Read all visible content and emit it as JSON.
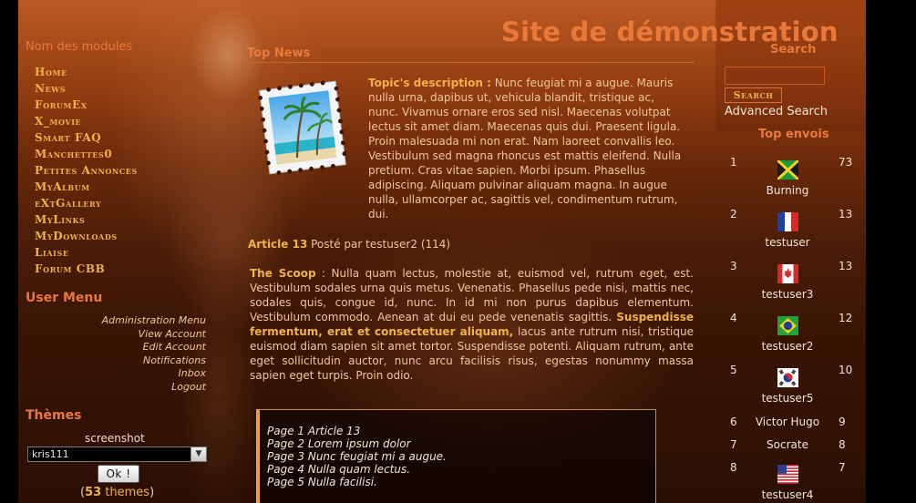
{
  "header": {
    "site_title": "Site de démonstration"
  },
  "sidebar": {
    "modules_title": "Nom des modules",
    "main_menu": [
      "Home",
      "News",
      "ForumEx",
      "X_movie",
      "Smart FAQ",
      "Manchettes0",
      "Petites Annonces",
      "MyAlbum",
      "eXtGallery",
      "MyLinks",
      "MyDownloads",
      "Liaise",
      "Forum CBB"
    ],
    "user_menu_title": "User Menu",
    "user_menu": [
      "Administration Menu",
      "View Account",
      "Edit Account",
      "Notifications",
      "Inbox",
      "Logout"
    ],
    "themes_title": "Thèmes",
    "screenshot_label": "screenshot",
    "theme_selected": "kris111",
    "ok_label": "Ok !",
    "themes_count_open": "(",
    "themes_count": "53",
    "themes_count_word": "themes",
    "themes_count_close": ")"
  },
  "main": {
    "top_news_title": "Top News",
    "topic_desc_label": "Topic's description :",
    "topic_desc_text": "Nunc feugiat mi a augue. Mauris nulla urna, dapibus ut, vehicula blandit, tristique ac, nunc. Vivamus ornare eros sed nisl. Maecenas volutpat lectus sit amet diam. Maecenas quis dui. Praesent ligula. Proin malesuada mi non erat. Nam laoreet convallis leo. Vestibulum sed magna rhoncus est mattis eleifend. Nulla pretium. Cras vitae sapien. Morbi ipsum. Phasellus adipiscing. Aliquam pulvinar aliquam magna. In augue nulla, ullamcorper ac, sagittis vel, condimentum rutrum, dui.",
    "article_title": "Article 13",
    "article_posted": "Posté par testuser2 (114)",
    "scoop_label": "The Scoop",
    "scoop_text_1": " : Nulla quam lectus, molestie at, euismod vel, rutrum eget, est. Vestibulum sodales urna quis metus. Venenatis. Phasellus pede nisi, mattis nec, sodales quis, congue id, nunc. In id mi non purus dapibus elementum. Vestibulum commodo. Aenean at dui eu pede venenatis sagittis. ",
    "scoop_bold": "Suspendisse fermentum, erat et consectetuer aliquam,",
    "scoop_text_2": " lacus ante rutrum nisi, tristique euismod diam sapien sit amet tortor. Suspendisse potenti. Aliquam rutrum, ante eget sollicitudin auctor, nunc arcu facilisis risus, egestas nonummy massa sapien eget turpis. Proin odio.",
    "pages": [
      "Page 1 Article 13",
      "Page 2 Lorem ipsum dolor",
      "Page 3 Nunc feugiat mi a augue.",
      "Page 4 Nulla quam lectus.",
      "Page 5 Nulla facilisi."
    ]
  },
  "right": {
    "search_title": "Search",
    "search_value": "",
    "search_button": "Search",
    "advanced_search": "Advanced Search",
    "top_envois_title": "Top envois",
    "posters": [
      {
        "rank": "1",
        "name": "Burning",
        "count": "73",
        "flag": "jamaica"
      },
      {
        "rank": "2",
        "name": "testuser",
        "count": "13",
        "flag": "france"
      },
      {
        "rank": "3",
        "name": "testuser3",
        "count": "13",
        "flag": "canada"
      },
      {
        "rank": "4",
        "name": "testuser2",
        "count": "12",
        "flag": "brazil"
      },
      {
        "rank": "5",
        "name": "testuser5",
        "count": "10",
        "flag": "south-korea"
      },
      {
        "rank": "6",
        "name": "Victor Hugo",
        "count": "9",
        "flag": ""
      },
      {
        "rank": "7",
        "name": "Socrate",
        "count": "8",
        "flag": ""
      },
      {
        "rank": "8",
        "name": "testuser4",
        "count": "7",
        "flag": "usa"
      }
    ]
  },
  "colors": {
    "title": "#e9793b",
    "menu_gold": "#f0b24a",
    "text": "#f0c79a"
  }
}
